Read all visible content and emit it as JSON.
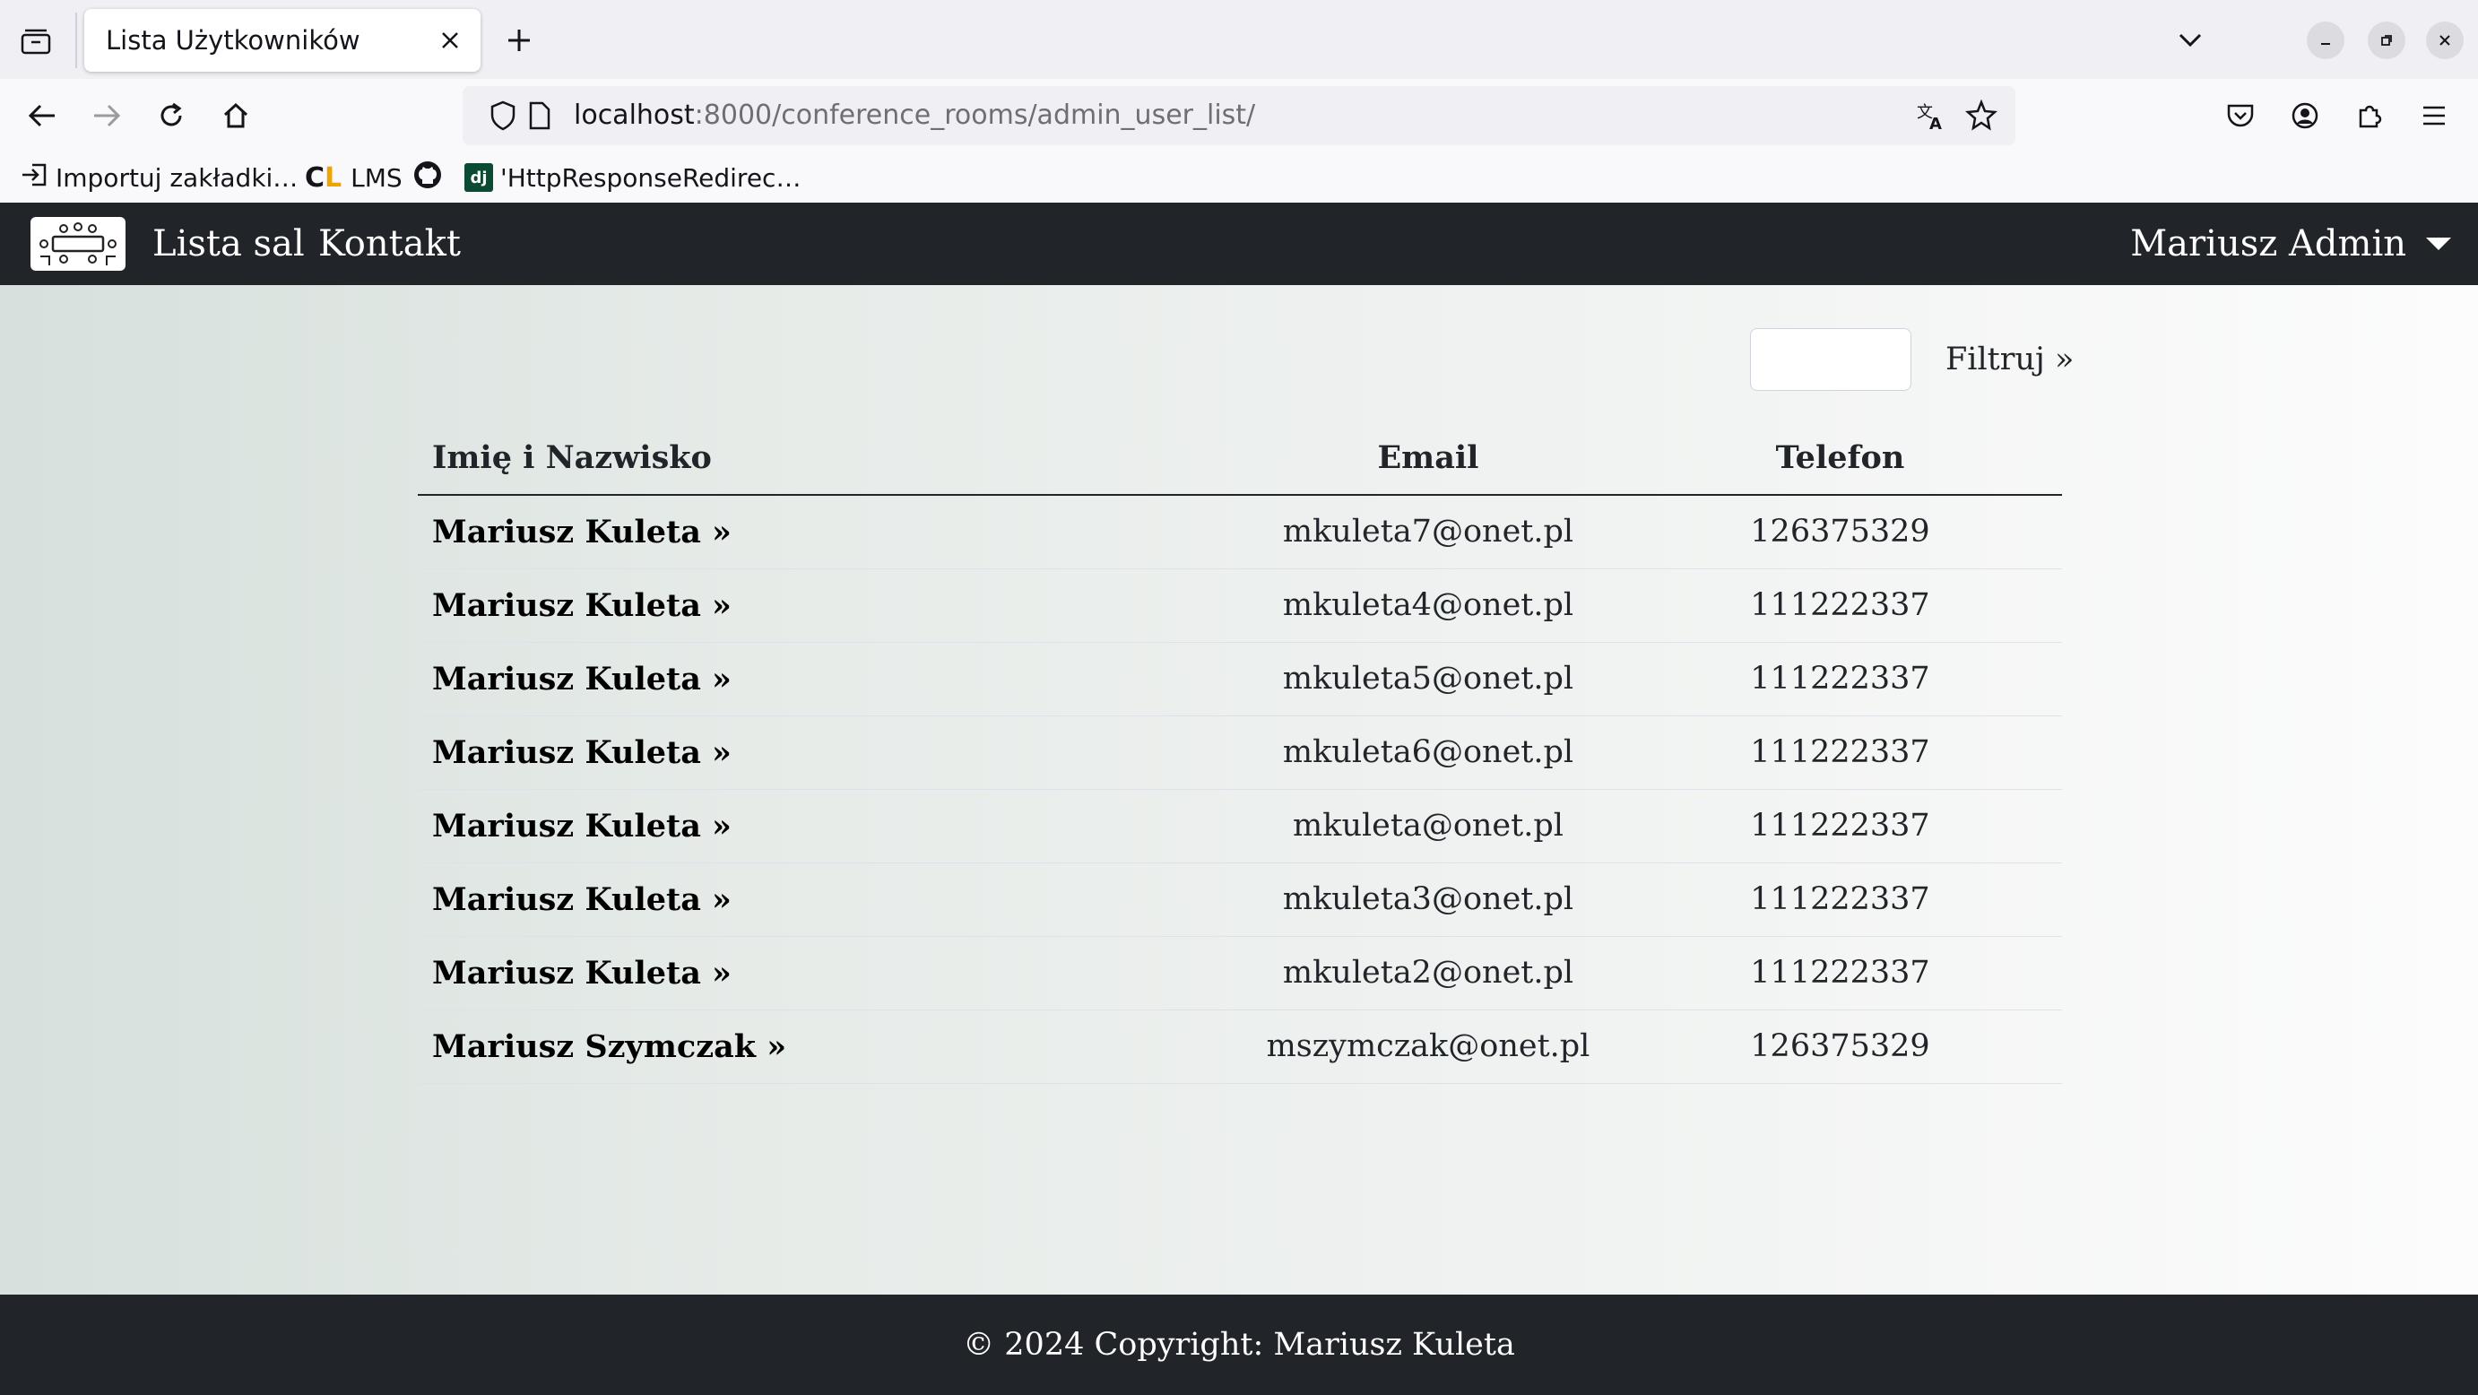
{
  "browser": {
    "tab_title": "Lista Użytkowników",
    "url_host": "localhost",
    "url_path": ":8000/conference_rooms/admin_user_list/",
    "bookmarks": [
      {
        "label": "Importuj zakładki…",
        "icon": "import-icon"
      },
      {
        "label": "LMS",
        "icon": "cl-logo-icon"
      },
      {
        "label": "",
        "icon": "github-icon"
      },
      {
        "label": "'HttpResponseRedirec…",
        "icon": "django-icon"
      }
    ]
  },
  "navbar": {
    "links": [
      "Lista sal",
      "Kontakt"
    ],
    "user": "Mariusz Admin"
  },
  "filter": {
    "input_value": "",
    "button_label": "Filtruj »"
  },
  "table": {
    "headers": [
      "Imię i Nazwisko",
      "Email",
      "Telefon"
    ],
    "rows": [
      {
        "name": "Mariusz Kuleta »",
        "email": "mkuleta7@onet.pl",
        "phone": "126375329"
      },
      {
        "name": "Mariusz Kuleta »",
        "email": "mkuleta4@onet.pl",
        "phone": "111222337"
      },
      {
        "name": "Mariusz Kuleta »",
        "email": "mkuleta5@onet.pl",
        "phone": "111222337"
      },
      {
        "name": "Mariusz Kuleta »",
        "email": "mkuleta6@onet.pl",
        "phone": "111222337"
      },
      {
        "name": "Mariusz Kuleta »",
        "email": "mkuleta@onet.pl",
        "phone": "111222337"
      },
      {
        "name": "Mariusz Kuleta »",
        "email": "mkuleta3@onet.pl",
        "phone": "111222337"
      },
      {
        "name": "Mariusz Kuleta »",
        "email": "mkuleta2@onet.pl",
        "phone": "111222337"
      },
      {
        "name": "Mariusz Szymczak »",
        "email": "mszymczak@onet.pl",
        "phone": "126375329"
      }
    ]
  },
  "footer": {
    "text": "© 2024 Copyright: Mariusz Kuleta"
  },
  "colors": {
    "navbar_bg": "#212529",
    "chrome_bg": "#f0f0f4",
    "text": "#212529"
  }
}
